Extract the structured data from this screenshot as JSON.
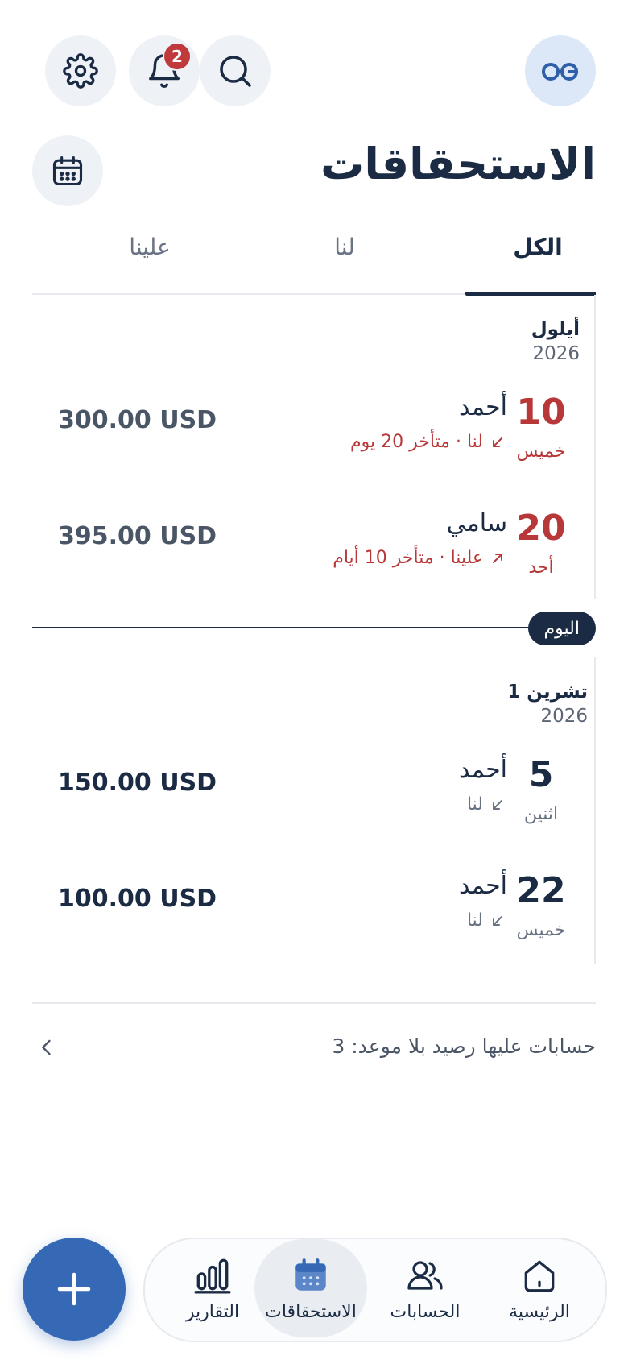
{
  "header": {
    "notification_count": "2",
    "title": "الاستحقاقات"
  },
  "tabs": [
    {
      "label": "الكل",
      "active": true
    },
    {
      "label": "لنا",
      "active": false
    },
    {
      "label": "علينا",
      "active": false
    }
  ],
  "groups": [
    {
      "month": "أيلول",
      "year": "2026",
      "items": [
        {
          "day": "10",
          "weekday": "خميس",
          "name": "أحمد",
          "status": "لنا · متأخر 20 يوم",
          "direction": "in",
          "amount": "300.00 USD",
          "overdue": true
        },
        {
          "day": "20",
          "weekday": "أحد",
          "name": "سامي",
          "status": "علينا · متأخر 10 أيام",
          "direction": "out",
          "amount": "395.00 USD",
          "overdue": true
        }
      ]
    },
    {
      "month": "تشرين 1",
      "year": "2026",
      "items": [
        {
          "day": "5",
          "weekday": "اثنين",
          "name": "أحمد",
          "status": "لنا",
          "direction": "in",
          "amount": "150.00 USD",
          "overdue": false
        },
        {
          "day": "22",
          "weekday": "خميس",
          "name": "أحمد",
          "status": "لنا",
          "direction": "in",
          "amount": "100.00 USD",
          "overdue": false
        }
      ]
    }
  ],
  "today_label": "اليوم",
  "footer_note": "حسابات عليها رصيد بلا موعد: 3",
  "nav": [
    {
      "label": "الرئيسية",
      "icon": "home-icon"
    },
    {
      "label": "الحسابات",
      "icon": "users-icon"
    },
    {
      "label": "الاستحقاقات",
      "icon": "calendar-icon",
      "active": true
    },
    {
      "label": "التقارير",
      "icon": "bar-chart-icon"
    }
  ],
  "colors": {
    "primary": "#1b2b44",
    "accent": "#3569b5",
    "overdue": "#b8383a",
    "badge": "#c0393b"
  }
}
